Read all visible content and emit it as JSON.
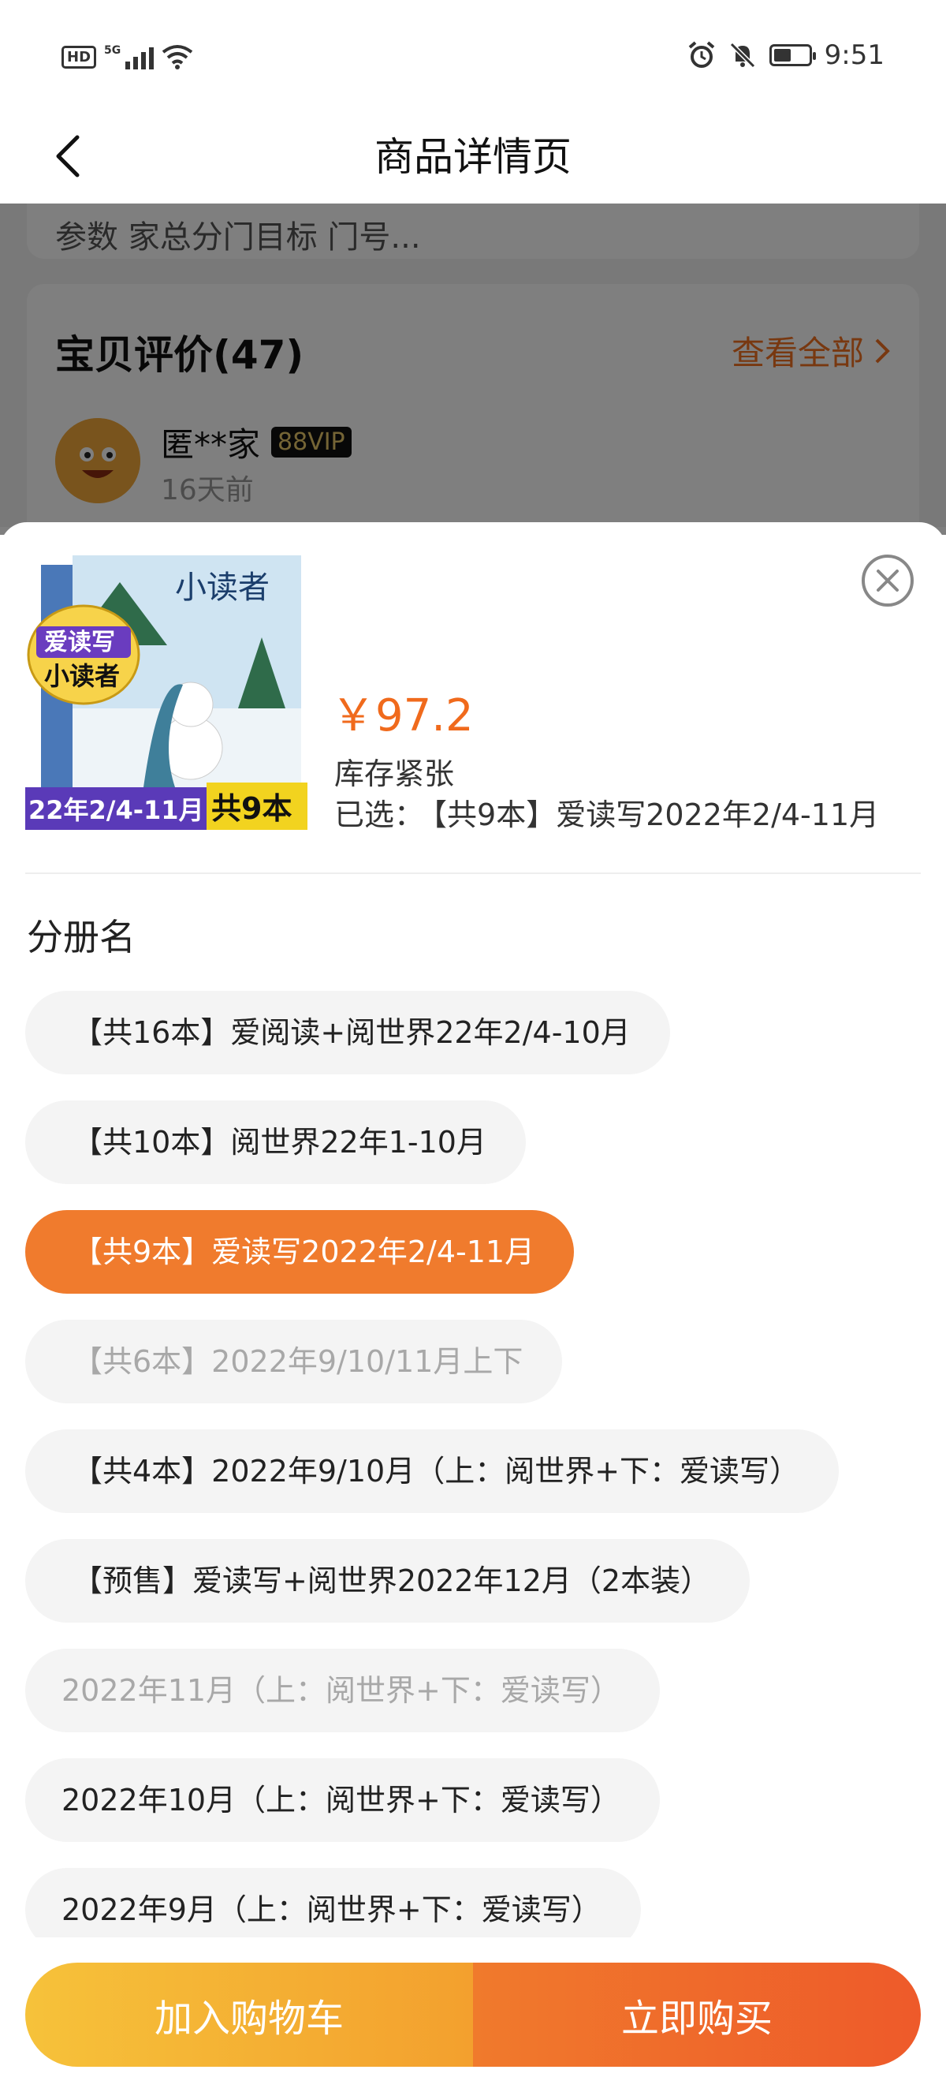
{
  "status_bar": {
    "hd": "HD",
    "network": "5G",
    "time": "9:51",
    "battery_level": 0.5
  },
  "header": {
    "title": "商品详情页"
  },
  "background": {
    "params_text": "参数    家总分门目标 门号...",
    "reviews": {
      "title": "宝贝评价(47)",
      "view_all": "查看全部",
      "reviewer": "匿**家",
      "vip": "88VIP",
      "time": "16天前"
    }
  },
  "sheet": {
    "price": "￥97.2",
    "stock": "库存紧张",
    "selected_label": "已选：",
    "selected_value": "【共9本】爱读写2022年2/4-11月",
    "thumb": {
      "badge_top": "爱读写",
      "badge_bottom": "小读者",
      "band_left": "22年2/4-11月",
      "band_right": "共9本",
      "cover_title": "小读者"
    },
    "group_name": "分册名",
    "options": [
      {
        "label": "【共16本】爱阅读+阅世界22年2/4-10月",
        "state": "normal"
      },
      {
        "label": "【共10本】阅世界22年1-10月",
        "state": "normal"
      },
      {
        "label": "【共9本】爱读写2022年2/4-11月",
        "state": "active"
      },
      {
        "label": "【共6本】2022年9/10/11月上下",
        "state": "disabled"
      },
      {
        "label": "【共4本】2022年9/10月（上：阅世界+下：爱读写）",
        "state": "normal"
      },
      {
        "label": "【预售】爱读写+阅世界2022年12月（2本装）",
        "state": "normal"
      },
      {
        "label": "2022年11月（上：阅世界+下：爱读写）",
        "state": "disabled"
      },
      {
        "label": "2022年10月（上：阅世界+下：爱读写）",
        "state": "normal"
      },
      {
        "label": "2022年9月（上：阅世界+下：爱读写）",
        "state": "normal"
      }
    ],
    "add_to_cart": "加入购物车",
    "buy_now": "立即购买"
  },
  "colors": {
    "accent": "#f07b2d",
    "price": "#f06a1c",
    "cart_button": "#f3a02e",
    "buy_button": "#ee5a2a"
  }
}
